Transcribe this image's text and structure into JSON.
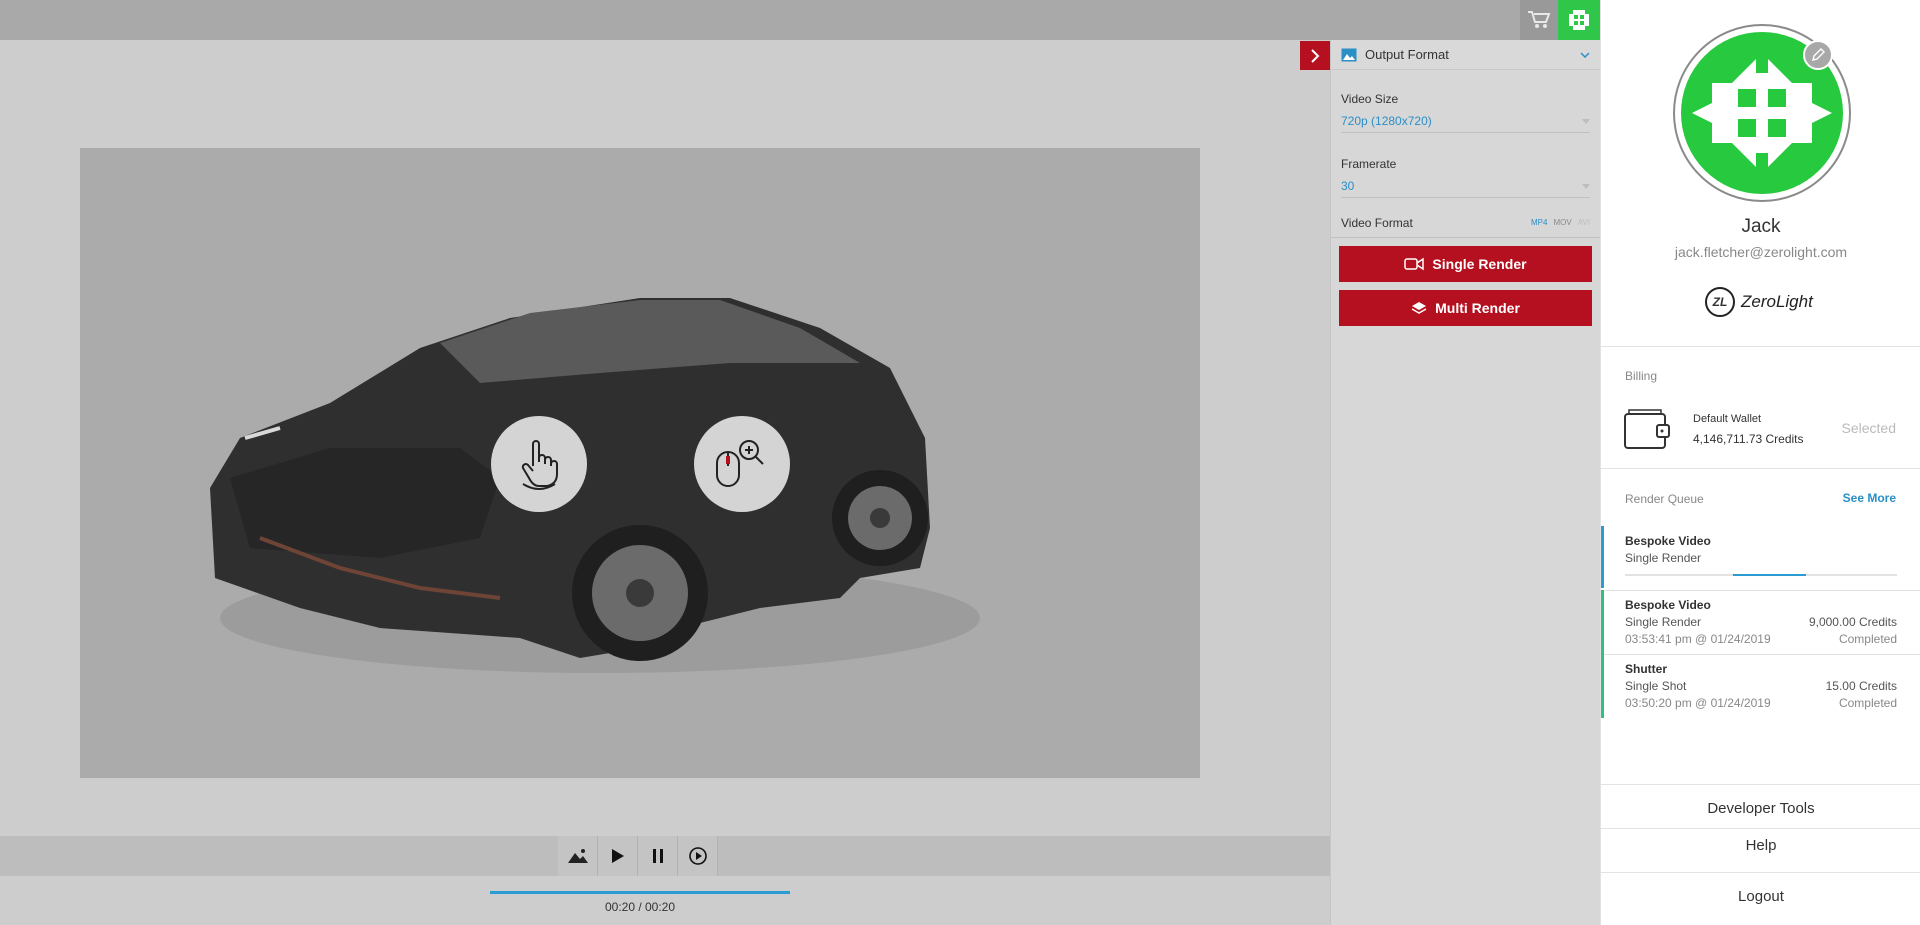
{
  "viewer": {
    "progress_fraction": 1.0,
    "time_display": "00:20 / 00:20",
    "hints": [
      "rotate-drag",
      "scroll-zoom"
    ]
  },
  "player": {
    "buttons": [
      "image-icon",
      "play-icon",
      "pause-icon",
      "replay-icon"
    ]
  },
  "settings": {
    "header": "Output Format",
    "video_size_label": "Video Size",
    "video_size_value": "720p (1280x720)",
    "framerate_label": "Framerate",
    "framerate_value": "30",
    "video_format_label": "Video Format",
    "formats": [
      "MP4",
      "MOV",
      "AVI"
    ],
    "selected_format": "MP4",
    "single_render_label": "Single Render",
    "multi_render_label": "Multi Render"
  },
  "account": {
    "name": "Jack",
    "email": "jack.fletcher@zerolight.com",
    "brand_badge": "ZL",
    "brand_name": "ZeroLight",
    "billing_label": "Billing",
    "wallet_name": "Default Wallet",
    "wallet_credits": "4,146,711.73 Credits",
    "wallet_state": "Selected",
    "queue_label": "Render Queue",
    "see_more": "See More",
    "queue": [
      {
        "title": "Bespoke Video",
        "type": "Single Render",
        "in_progress": true,
        "progress": 0.75
      },
      {
        "title": "Bespoke Video",
        "type": "Single Render",
        "cost": "9,000.00 Credits",
        "time": "03:53:41 pm @ 01/24/2019",
        "status": "Completed"
      },
      {
        "title": "Shutter",
        "type": "Single Shot",
        "cost": "15.00 Credits",
        "time": "03:50:20 pm @ 01/24/2019",
        "status": "Completed"
      }
    ],
    "developer_tools": "Developer Tools",
    "help": "Help",
    "logout": "Logout"
  },
  "colors": {
    "accent_red": "#b5101f",
    "accent_blue": "#2a9bd3",
    "avatar_green": "#27c93f",
    "completed_green": "#2fc27f"
  }
}
